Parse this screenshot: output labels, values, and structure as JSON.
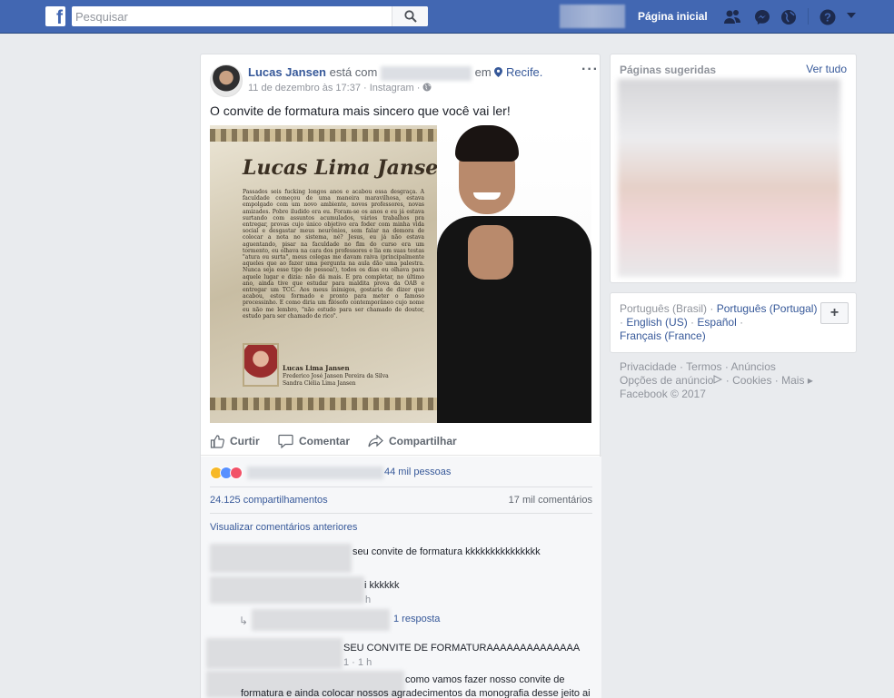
{
  "topbar": {
    "logo_letter": "f",
    "search_placeholder": "Pesquisar",
    "home_label": "Página inicial",
    "icons": [
      "friends-icon",
      "messenger-icon",
      "globe-icon",
      "help-icon",
      "dropdown-caret-icon"
    ]
  },
  "post": {
    "author_name": "Lucas Jansen",
    "with_text": "está com",
    "in_text": "em",
    "location": "Recife.",
    "date": "11 de dezembro às 17:37",
    "source": "Instagram",
    "meta_dot": "·",
    "text": "O convite de formatura mais sincero que você vai ler!",
    "invite": {
      "title": "Lucas Lima Jansen",
      "body": "Passados seis fucking longos anos e acabou essa desgraça. A faculdade começou de uma maneira maravilhosa, estava empolgado com um novo ambiente, novos professores, novas amizades. Pobre iludido era eu. Foram-se os anos e eu já estava surtando com assuntos acumulados, vários trabalhos pra entregar, provas cujo único objetivo era foder com minha vida social e desgastar meus neurônios, sem falar na demora de colocar a nota no sistema, né? Jesus, eu já não estava aguentando, pisar na faculdade no fim do curso era um tormento, eu olhava na cara dos professores e lia em suas testas \"atura ou surta\", meus colegas me davam raiva (principalmente aqueles que ao fazer uma pergunta na aula dão uma palestra. Nunca seja esse tipo de pessoa!), todos os dias eu olhava para aquele lugar e dizia: não dá mais. E pra completar, no último ano, ainda tive que estudar para maldita prova da OAB e entregar um TCC. Aos meus inimigos, gostaria de dizer que acabou, estou formado e pronto para meter o famoso processinho. E como diria um filósofo contemporâneo cujo nome eu não me lembro, \"não estudo para ser chamado de doutor, estudo para ser chamado de rico\".",
      "sign_name": "Lucas Lima Jansen",
      "sign_parent1": "Frederico José Jansen Pereira da Silva",
      "sign_parent2": "Sandra Clélia Lima Jansen"
    },
    "actions": {
      "like": "Curtir",
      "comment": "Comentar",
      "share": "Compartilhar"
    },
    "reactions_count": "44 mil pessoas",
    "shares": "24.125 compartilhamentos",
    "comments_count": "17 mil comentários",
    "view_previous": "Visualizar comentários anteriores",
    "comments": [
      {
        "text": "seu convite de formatura",
        "laugh": "kkkkkkkkkkkkkkk"
      },
      {
        "text": "i kkkkkk",
        "time": "h"
      },
      {
        "reply": "1 resposta"
      },
      {
        "text": "SEU CONVITE DE FORMATURAAAAAAAAAAAAAA",
        "time": "1 · 1 h"
      },
      {
        "line1": "como vamos fazer nosso convite de",
        "line2": "formatura e ainda colocar nossos agradecimentos da monografia desse jeito ai"
      }
    ]
  },
  "sidebar": {
    "suggested_title": "Páginas sugeridas",
    "see_all": "Ver tudo",
    "languages": {
      "current": "Português (Brasil)",
      "others": [
        "Português (Portugal)",
        "English (US)",
        "Español",
        "Français (France)"
      ],
      "separator": "·",
      "plus": "+"
    },
    "footer": {
      "privacy": "Privacidade",
      "terms": "Termos",
      "ads": "Anúncios",
      "ad_choices": "Opções de anúncio",
      "cookies": "Cookies",
      "more": "Mais",
      "copyright": "Facebook © 2017"
    }
  },
  "colors": {
    "brand_blue": "#4267b2",
    "link_blue": "#365899",
    "bg_gray": "#e9ebee"
  }
}
